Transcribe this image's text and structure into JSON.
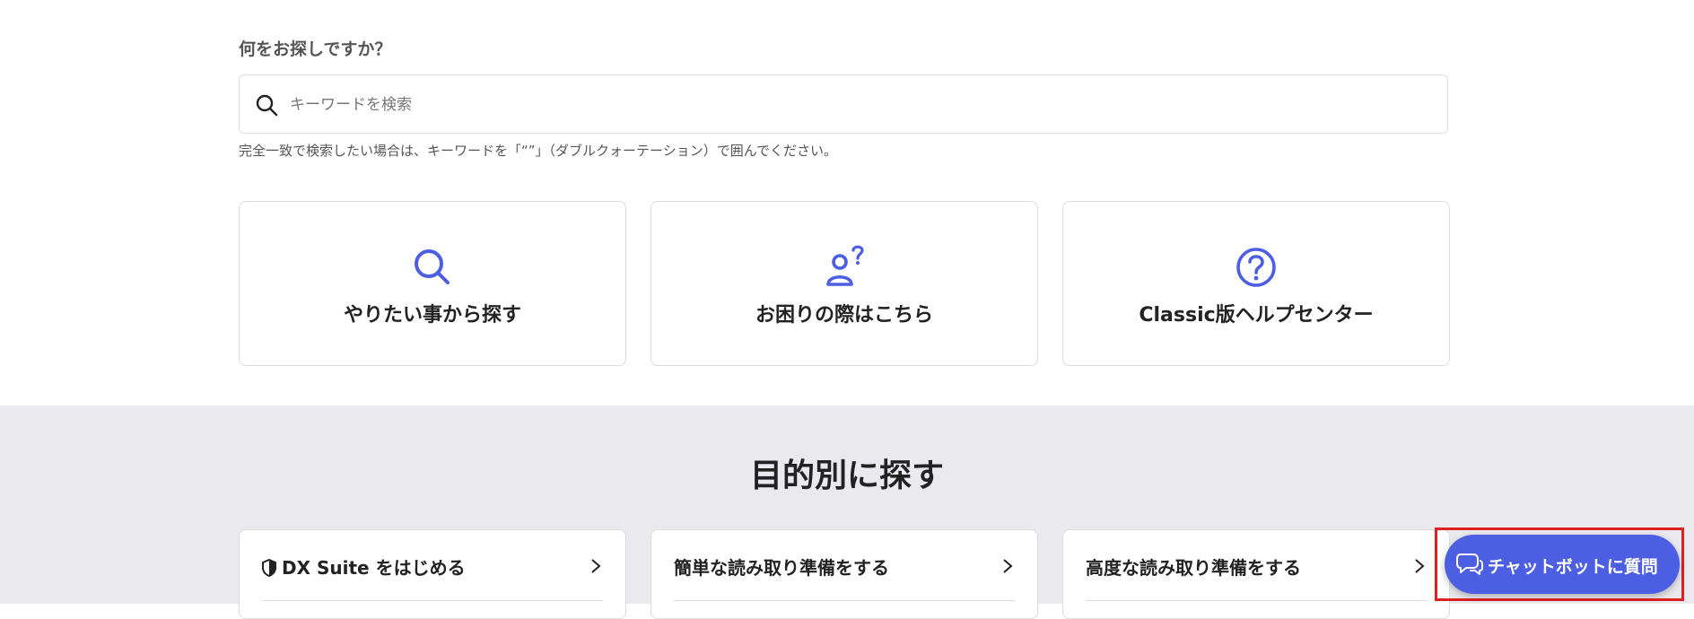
{
  "search": {
    "heading": "何をお探しですか？",
    "placeholder": "キーワードを検索",
    "hint": "完全一致で検索したい場合は、キーワードを「“”」（ダブルクォーテーション）で囲んでください。",
    "icon": "search-icon"
  },
  "quick_links": [
    {
      "label": "やりたい事から探す",
      "icon": "search-icon"
    },
    {
      "label": "お困りの際はこちら",
      "icon": "person-question-icon"
    },
    {
      "label": "Classic版ヘルプセンター",
      "icon": "question-circle-icon"
    }
  ],
  "purpose_section": {
    "title": "目的別に探す",
    "cards": [
      {
        "label": "DX Suite をはじめる",
        "icon": "shield-icon"
      },
      {
        "label": "簡単な読み取り準備をする"
      },
      {
        "label": "高度な読み取り準備をする"
      }
    ]
  },
  "chatbot": {
    "label": "チャットボットに質問",
    "icon": "chat-bubbles-icon"
  },
  "colors": {
    "accent": "#4c5ee2",
    "section_background": "#e9e9ee",
    "highlight_border": "#e02020"
  }
}
